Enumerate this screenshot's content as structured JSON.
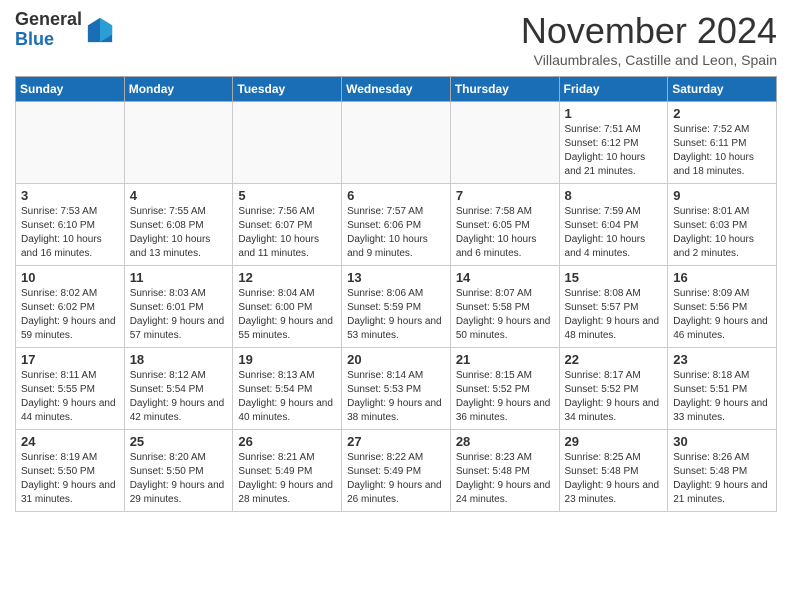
{
  "header": {
    "logo_general": "General",
    "logo_blue": "Blue",
    "month": "November 2024",
    "location": "Villaumbrales, Castille and Leon, Spain"
  },
  "weekdays": [
    "Sunday",
    "Monday",
    "Tuesday",
    "Wednesday",
    "Thursday",
    "Friday",
    "Saturday"
  ],
  "weeks": [
    [
      {
        "day": "",
        "info": "",
        "empty": true
      },
      {
        "day": "",
        "info": "",
        "empty": true
      },
      {
        "day": "",
        "info": "",
        "empty": true
      },
      {
        "day": "",
        "info": "",
        "empty": true
      },
      {
        "day": "",
        "info": "",
        "empty": true
      },
      {
        "day": "1",
        "info": "Sunrise: 7:51 AM\nSunset: 6:12 PM\nDaylight: 10 hours and 21 minutes."
      },
      {
        "day": "2",
        "info": "Sunrise: 7:52 AM\nSunset: 6:11 PM\nDaylight: 10 hours and 18 minutes."
      }
    ],
    [
      {
        "day": "3",
        "info": "Sunrise: 7:53 AM\nSunset: 6:10 PM\nDaylight: 10 hours and 16 minutes."
      },
      {
        "day": "4",
        "info": "Sunrise: 7:55 AM\nSunset: 6:08 PM\nDaylight: 10 hours and 13 minutes."
      },
      {
        "day": "5",
        "info": "Sunrise: 7:56 AM\nSunset: 6:07 PM\nDaylight: 10 hours and 11 minutes."
      },
      {
        "day": "6",
        "info": "Sunrise: 7:57 AM\nSunset: 6:06 PM\nDaylight: 10 hours and 9 minutes."
      },
      {
        "day": "7",
        "info": "Sunrise: 7:58 AM\nSunset: 6:05 PM\nDaylight: 10 hours and 6 minutes."
      },
      {
        "day": "8",
        "info": "Sunrise: 7:59 AM\nSunset: 6:04 PM\nDaylight: 10 hours and 4 minutes."
      },
      {
        "day": "9",
        "info": "Sunrise: 8:01 AM\nSunset: 6:03 PM\nDaylight: 10 hours and 2 minutes."
      }
    ],
    [
      {
        "day": "10",
        "info": "Sunrise: 8:02 AM\nSunset: 6:02 PM\nDaylight: 9 hours and 59 minutes."
      },
      {
        "day": "11",
        "info": "Sunrise: 8:03 AM\nSunset: 6:01 PM\nDaylight: 9 hours and 57 minutes."
      },
      {
        "day": "12",
        "info": "Sunrise: 8:04 AM\nSunset: 6:00 PM\nDaylight: 9 hours and 55 minutes."
      },
      {
        "day": "13",
        "info": "Sunrise: 8:06 AM\nSunset: 5:59 PM\nDaylight: 9 hours and 53 minutes."
      },
      {
        "day": "14",
        "info": "Sunrise: 8:07 AM\nSunset: 5:58 PM\nDaylight: 9 hours and 50 minutes."
      },
      {
        "day": "15",
        "info": "Sunrise: 8:08 AM\nSunset: 5:57 PM\nDaylight: 9 hours and 48 minutes."
      },
      {
        "day": "16",
        "info": "Sunrise: 8:09 AM\nSunset: 5:56 PM\nDaylight: 9 hours and 46 minutes."
      }
    ],
    [
      {
        "day": "17",
        "info": "Sunrise: 8:11 AM\nSunset: 5:55 PM\nDaylight: 9 hours and 44 minutes."
      },
      {
        "day": "18",
        "info": "Sunrise: 8:12 AM\nSunset: 5:54 PM\nDaylight: 9 hours and 42 minutes."
      },
      {
        "day": "19",
        "info": "Sunrise: 8:13 AM\nSunset: 5:54 PM\nDaylight: 9 hours and 40 minutes."
      },
      {
        "day": "20",
        "info": "Sunrise: 8:14 AM\nSunset: 5:53 PM\nDaylight: 9 hours and 38 minutes."
      },
      {
        "day": "21",
        "info": "Sunrise: 8:15 AM\nSunset: 5:52 PM\nDaylight: 9 hours and 36 minutes."
      },
      {
        "day": "22",
        "info": "Sunrise: 8:17 AM\nSunset: 5:52 PM\nDaylight: 9 hours and 34 minutes."
      },
      {
        "day": "23",
        "info": "Sunrise: 8:18 AM\nSunset: 5:51 PM\nDaylight: 9 hours and 33 minutes."
      }
    ],
    [
      {
        "day": "24",
        "info": "Sunrise: 8:19 AM\nSunset: 5:50 PM\nDaylight: 9 hours and 31 minutes."
      },
      {
        "day": "25",
        "info": "Sunrise: 8:20 AM\nSunset: 5:50 PM\nDaylight: 9 hours and 29 minutes."
      },
      {
        "day": "26",
        "info": "Sunrise: 8:21 AM\nSunset: 5:49 PM\nDaylight: 9 hours and 28 minutes."
      },
      {
        "day": "27",
        "info": "Sunrise: 8:22 AM\nSunset: 5:49 PM\nDaylight: 9 hours and 26 minutes."
      },
      {
        "day": "28",
        "info": "Sunrise: 8:23 AM\nSunset: 5:48 PM\nDaylight: 9 hours and 24 minutes."
      },
      {
        "day": "29",
        "info": "Sunrise: 8:25 AM\nSunset: 5:48 PM\nDaylight: 9 hours and 23 minutes."
      },
      {
        "day": "30",
        "info": "Sunrise: 8:26 AM\nSunset: 5:48 PM\nDaylight: 9 hours and 21 minutes."
      }
    ]
  ]
}
